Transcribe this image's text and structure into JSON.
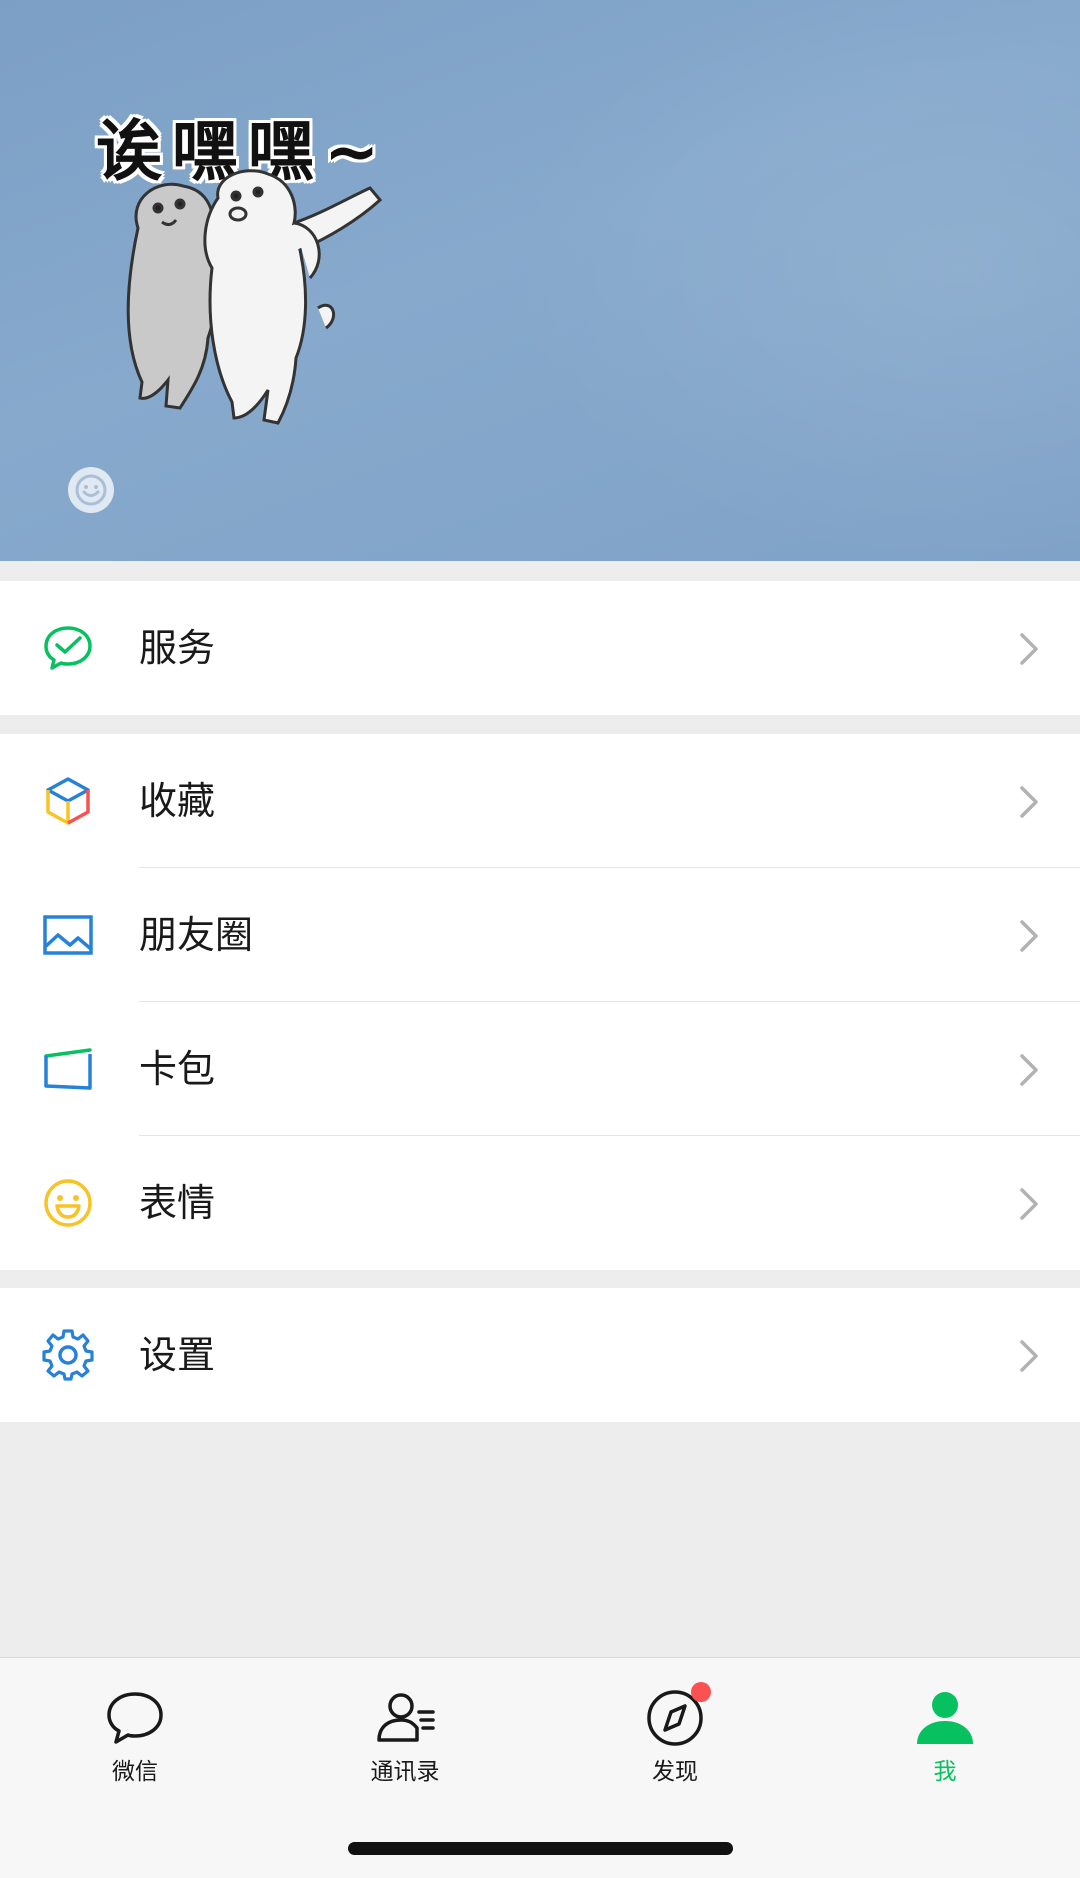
{
  "banner": {
    "sticker_text": "诶嘿嘿~"
  },
  "menu": {
    "service": {
      "label": "服务",
      "icon": "wechat-pay-icon",
      "color": "#07c160"
    },
    "favorites": {
      "label": "收藏",
      "icon": "cube-icon"
    },
    "moments": {
      "label": "朋友圈",
      "icon": "image-icon",
      "color": "#2782d7"
    },
    "cards": {
      "label": "卡包",
      "icon": "wallet-icon",
      "color": "#2782d7"
    },
    "stickers": {
      "label": "表情",
      "icon": "smiley-icon",
      "color": "#f7c325"
    },
    "settings": {
      "label": "设置",
      "icon": "gear-icon",
      "color": "#2782d7"
    }
  },
  "tabbar": {
    "tabs": [
      {
        "label": "微信",
        "icon": "chat-bubble-icon"
      },
      {
        "label": "通讯录",
        "icon": "contacts-icon"
      },
      {
        "label": "发现",
        "icon": "compass-icon",
        "badge": true
      },
      {
        "label": "我",
        "icon": "person-icon",
        "active": true
      }
    ]
  },
  "colors": {
    "accent": "#07c160",
    "banner": "#86a9cc",
    "badge": "#fa5151"
  }
}
